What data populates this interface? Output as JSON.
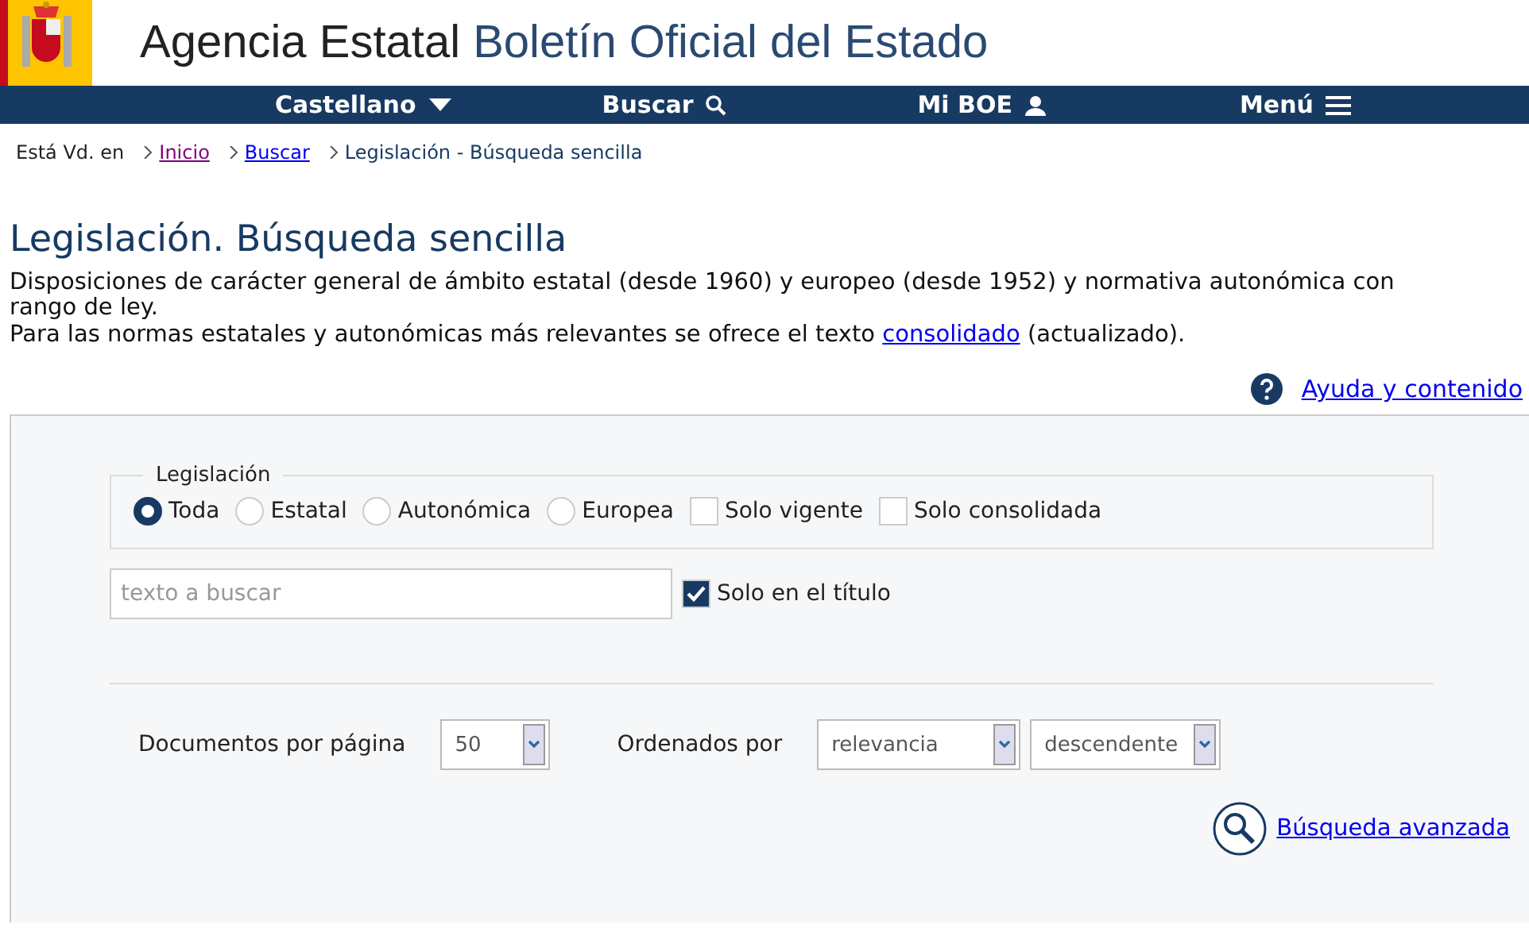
{
  "header": {
    "title_plain": "Agencia Estatal",
    "title_accent": "Boletín Oficial del Estado"
  },
  "nav": [
    {
      "label": "Castellano"
    },
    {
      "label": "Buscar"
    },
    {
      "label": "Mi BOE"
    },
    {
      "label": "Menú"
    }
  ],
  "breadcrumb": {
    "prefix": "Está Vd. en",
    "items": [
      {
        "label": "Inicio",
        "kind": "visited"
      },
      {
        "label": "Buscar",
        "kind": "link"
      },
      {
        "label": "Legislación - Búsqueda sencilla",
        "kind": "current"
      }
    ]
  },
  "page": {
    "title": "Legislación. Búsqueda sencilla",
    "description": "Disposiciones de carácter general de ámbito estatal (desde 1960) y europeo (desde 1952) y normativa autonómica con rango de ley.",
    "note_before": "Para las normas estatales y autonómicas más relevantes se ofrece el texto",
    "note_link": "consolidado",
    "note_after": "(actualizado).",
    "help": "Ayuda y contenido"
  },
  "form": {
    "legend": "Legislación",
    "options": [
      {
        "kind": "radio",
        "label": "Toda",
        "selected": true
      },
      {
        "kind": "radio",
        "label": "Estatal",
        "selected": false
      },
      {
        "kind": "radio",
        "label": "Autonómica",
        "selected": false
      },
      {
        "kind": "radio",
        "label": "Europea",
        "selected": false
      },
      {
        "kind": "checkbox",
        "label": "Solo vigente",
        "checked": false
      },
      {
        "kind": "checkbox",
        "label": "Solo consolidada",
        "checked": false
      }
    ],
    "search": {
      "placeholder": "texto a buscar"
    },
    "title_only": {
      "label": "Solo en el título",
      "checked": true
    },
    "per_page": {
      "label": "Documentos por página",
      "value": "50"
    },
    "order": {
      "label": "Ordenados por",
      "field": "relevancia",
      "direction": "descendente"
    },
    "advanced": "Búsqueda avanzada"
  }
}
